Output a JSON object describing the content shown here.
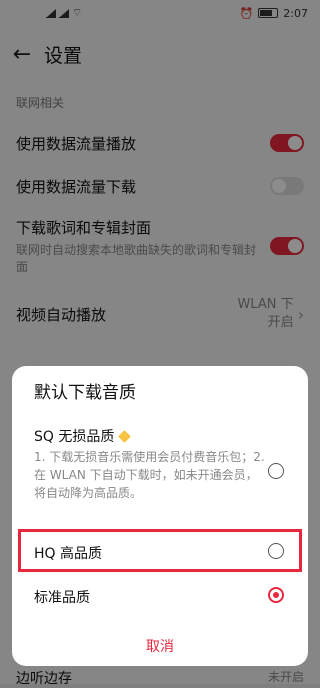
{
  "status": {
    "time": "2:07"
  },
  "header": {
    "title": "设置"
  },
  "section": {
    "network": "联网相关"
  },
  "settings": {
    "stream_play": "使用数据流量播放",
    "stream_download": "使用数据流量下载",
    "download_cover": "下载歌词和专辑封面",
    "download_cover_desc": "联网时自动搜索本地歌曲缺失的歌词和专辑封面",
    "video_autoplay": "视频自动播放",
    "video_autoplay_value": "WLAN 下开启"
  },
  "bottom_partial": {
    "left": "边听边存",
    "right": "未开启"
  },
  "dialog": {
    "title": "默认下载音质",
    "sq_title": "SQ 无损品质",
    "sq_desc": "1. 下载无损音乐需使用会员付费音乐包；2. 在 WLAN 下自动下载时，如未开通会员，将自动降为高品质。",
    "hq_title": "HQ 高品质",
    "std_title": "标准品质",
    "cancel": "取消",
    "selected": "标准品质"
  },
  "colors": {
    "accent": "#e8283f"
  }
}
